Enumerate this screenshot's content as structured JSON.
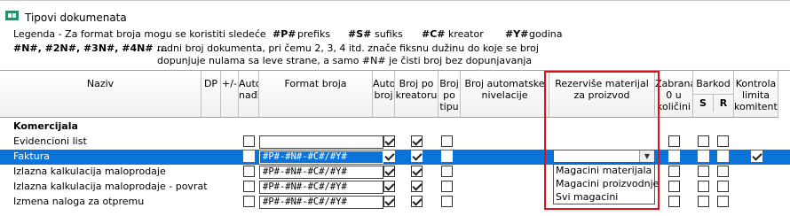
{
  "window": {
    "title": "Tipovi dokumenata",
    "icon": "document-types-icon"
  },
  "legend": {
    "intro": "Legenda - Za format broja mogu se koristiti sledeće",
    "prefix_code": "#P#",
    "prefix_text": "prefiks",
    "suffix_code": "#S#",
    "suffix_text": "sufiks",
    "creator_code": "#C#",
    "creator_text": "kreator",
    "year_code": "#Y#",
    "year_text": "godina",
    "n_codes": "#N#, #2N#, #3N#, #4N# ...",
    "n_text_1": "redni broj dokumenta, pri čemu 2, 3, 4 itd. znače fiksnu dužinu do koje se broj",
    "n_text_2": "dopunjuje nulama sa leve strane, a samo #N# je čisti broj bez dopunjavanja"
  },
  "columns": {
    "naziv": "Naziv",
    "dp": "DP",
    "plus_minus": "+/-",
    "auto_nadji": "Auto nađi",
    "format_broja": "Format broja",
    "auto_broj": "Auto broj",
    "broj_po_kreatoru": "Broj po kreatoru",
    "broj_po_tipu": "Broj po tipu",
    "broj_automatske_nivelacije": "Broj automatske nivelacije",
    "rezervise": "Rezerviše materijal za proizvod",
    "zabrana": "Zabrana 0 u količini",
    "barkod": "Barkod",
    "barkod_s": "S",
    "barkod_r": "R",
    "kontrola": "Kontrola limita komitenta"
  },
  "group": "Komercijala",
  "rows": [
    {
      "name": "Evidencioni list",
      "format": ""
    },
    {
      "name": "Faktura",
      "format": "#P#-#N#-#C#/#Y#",
      "selected": true
    },
    {
      "name": "Izlazna kalkulacija maloprodaje",
      "format": "#P#-#N#-#C#/#Y#"
    },
    {
      "name": "Izlazna kalkulacija maloprodaje - povrat",
      "format": "#P#-#N#-#C#/#Y#"
    },
    {
      "name": "Izmena naloga za otpremu",
      "format": "#P#-#N#-#C#/#Y#"
    }
  ],
  "dropdown": {
    "value": "",
    "options": [
      "Magacini materijala",
      "Magacini proizvodnje",
      "Svi magacini"
    ]
  }
}
